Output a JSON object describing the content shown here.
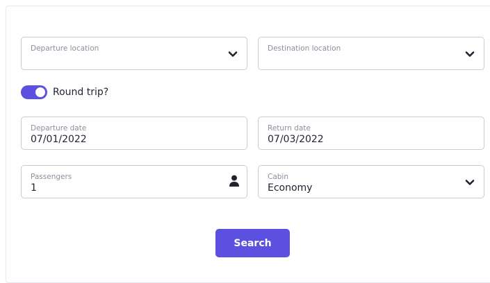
{
  "form": {
    "departure_location": {
      "label": "Departure location",
      "value": ""
    },
    "destination_location": {
      "label": "Destination location",
      "value": ""
    },
    "round_trip": {
      "label": "Round trip?",
      "enabled": true
    },
    "departure_date": {
      "label": "Departure date",
      "value": "07/01/2022"
    },
    "return_date": {
      "label": "Return date",
      "value": "07/03/2022"
    },
    "passengers": {
      "label": "Passengers",
      "value": "1"
    },
    "cabin": {
      "label": "Cabin",
      "value": "Economy"
    },
    "search_label": "Search"
  },
  "colors": {
    "accent": "#5b50e0",
    "border": "#c9ccd4",
    "label_text": "#8a8f9c",
    "text": "#1f2330"
  },
  "icons": {
    "select_arrow": "chevron-down-icon",
    "passengers": "person-icon"
  }
}
